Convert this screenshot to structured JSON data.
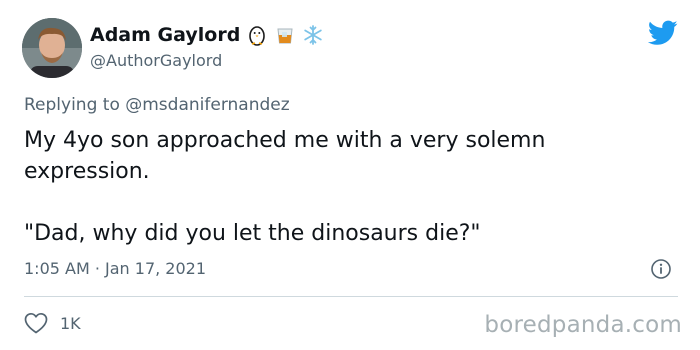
{
  "author": {
    "display_name": "Adam Gaylord",
    "handle": "@AuthorGaylord",
    "name_emojis": [
      "penguin-icon",
      "whiskey-glass-icon",
      "snowflake-icon"
    ]
  },
  "reply": {
    "prefix": "Replying to",
    "mention": "@msdanifernandez"
  },
  "tweet": {
    "line1": "My 4yo son approached me with a very solemn expression.",
    "line2": "\"Dad, why did you let the dinosaurs die?\"",
    "timestamp": "1:05 AM · Jan 17, 2021"
  },
  "engagement": {
    "likes": "1K"
  },
  "watermark": "boredpanda.com",
  "colors": {
    "text": "#0f1419",
    "secondary": "#536471",
    "twitter_blue": "#1d9bf0",
    "divider": "#cfd9de"
  }
}
